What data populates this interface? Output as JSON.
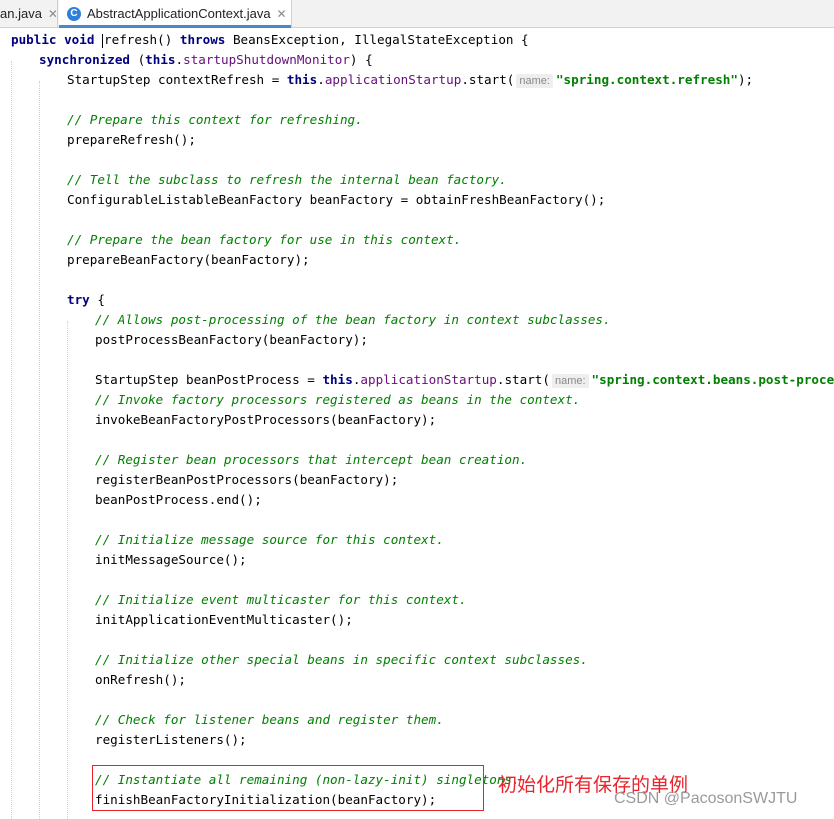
{
  "tabs": [
    {
      "label": "an.java"
    },
    {
      "label": "AbstractApplicationContext.java",
      "icon": "class-icon",
      "icon_letter": "C"
    }
  ],
  "code": {
    "l1_kw1": "public",
    "l1_kw2": "void",
    "l1_method": "refresh",
    "l1_rest1": "() ",
    "l1_throws": "throws",
    "l1_rest2": " BeansException, IllegalStateException {",
    "l2_sync": "synchronized",
    "l2_open": " (",
    "l2_this": "this",
    "l2_dot": ".",
    "l2_field": "startupShutdownMonitor",
    "l2_close": ") {",
    "l3_pre": "StartupStep contextRefresh = ",
    "l3_this": "this",
    "l3_dot": ".",
    "l3_field": "applicationStartup",
    "l3_call": ".start(",
    "l3_hint": "name:",
    "l3_str": "\"spring.context.refresh\"",
    "l3_end": ");",
    "c1": "// Prepare this context for refreshing.",
    "s1": "prepareRefresh();",
    "c2": "// Tell the subclass to refresh the internal bean factory.",
    "s2": "ConfigurableListableBeanFactory beanFactory = obtainFreshBeanFactory();",
    "c3": "// Prepare the bean factory for use in this context.",
    "s3": "prepareBeanFactory(beanFactory);",
    "try_kw": "try",
    "try_brace": " {",
    "c4": "// Allows post-processing of the bean factory in context subclasses.",
    "s4": "postProcessBeanFactory(beanFactory);",
    "l5_pre": "StartupStep beanPostProcess = ",
    "l5_this": "this",
    "l5_dot": ".",
    "l5_field": "applicationStartup",
    "l5_call": ".start(",
    "l5_hint": "name:",
    "l5_str": "\"spring.context.beans.post-process\"",
    "l5_end": ");",
    "c5": "// Invoke factory processors registered as beans in the context.",
    "s5": "invokeBeanFactoryPostProcessors(beanFactory);",
    "c6": "// Register bean processors that intercept bean creation.",
    "s6": "registerBeanPostProcessors(beanFactory);",
    "s6b": "beanPostProcess.end();",
    "c7": "// Initialize message source for this context.",
    "s7": "initMessageSource();",
    "c8": "// Initialize event multicaster for this context.",
    "s8": "initApplicationEventMulticaster();",
    "c9": "// Initialize other special beans in specific context subclasses.",
    "s9": "onRefresh();",
    "c10": "// Check for listener beans and register them.",
    "s10": "registerListeners();",
    "c11": "// Instantiate all remaining (non-lazy-init) singletons.",
    "s11": "finishBeanFactoryInitialization(beanFactory);"
  },
  "annotation": "初始化所有保存的单例",
  "watermark": "CSDN @PacosonSWJTU",
  "colors": {
    "keyword": "#000080",
    "field": "#660e7a",
    "string": "#008000",
    "comment": "#008000",
    "highlight": "#e8242c"
  }
}
